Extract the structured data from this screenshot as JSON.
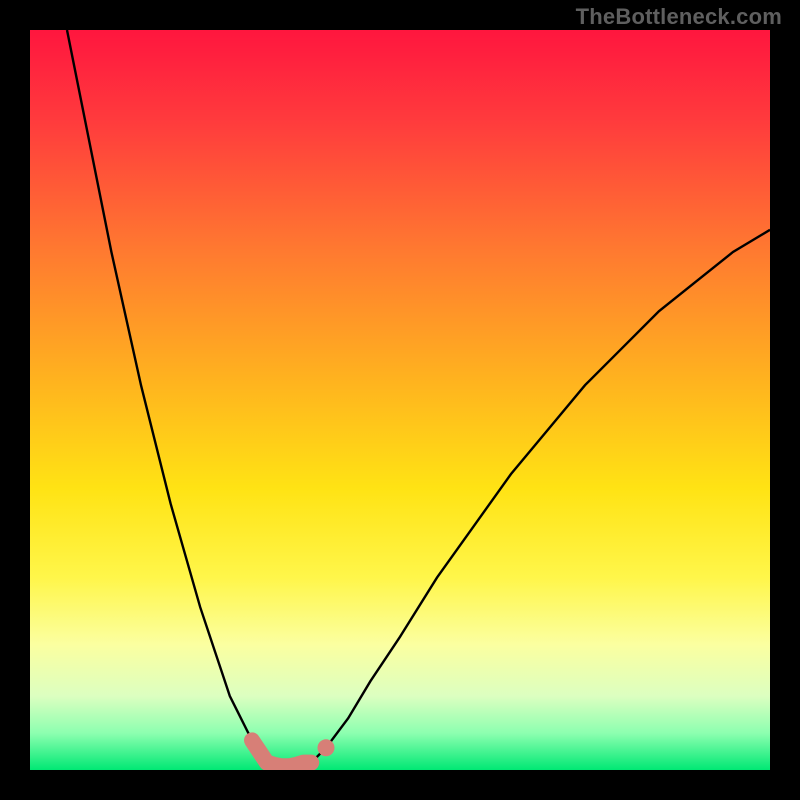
{
  "watermark": "TheBottleneck.com",
  "colors": {
    "background": "#000000",
    "curve": "#000000",
    "highlight": "#d77f77",
    "gradient_top": "#ff163e",
    "gradient_mid": "#ffe314",
    "gradient_bottom": "#00e874"
  },
  "chart_data": {
    "type": "line",
    "title": "",
    "xlabel": "",
    "ylabel": "",
    "xlim": [
      0,
      100
    ],
    "ylim": [
      0,
      100
    ],
    "series": [
      {
        "name": "left-branch",
        "x": [
          5,
          7,
          9,
          11,
          13,
          15,
          17,
          19,
          21,
          23,
          25,
          26,
          27,
          28,
          29,
          30,
          31,
          32
        ],
        "values": [
          100,
          90,
          80,
          70,
          61,
          52,
          44,
          36,
          29,
          22,
          16,
          13,
          10,
          8,
          6,
          4,
          2.5,
          1
        ]
      },
      {
        "name": "right-branch",
        "x": [
          38,
          40,
          43,
          46,
          50,
          55,
          60,
          65,
          70,
          75,
          80,
          85,
          90,
          95,
          100
        ],
        "values": [
          1,
          3,
          7,
          12,
          18,
          26,
          33,
          40,
          46,
          52,
          57,
          62,
          66,
          70,
          73
        ]
      },
      {
        "name": "bottom-flat",
        "x": [
          32,
          34,
          36,
          38
        ],
        "values": [
          1,
          0.5,
          0.5,
          1
        ]
      }
    ],
    "highlight": {
      "segment_x": [
        30,
        31,
        32,
        33,
        34,
        35,
        36,
        37,
        38
      ],
      "segment_values": [
        4,
        2.5,
        1,
        0.7,
        0.5,
        0.5,
        0.7,
        1,
        1
      ],
      "dot": {
        "x": 40,
        "y": 3
      }
    }
  }
}
